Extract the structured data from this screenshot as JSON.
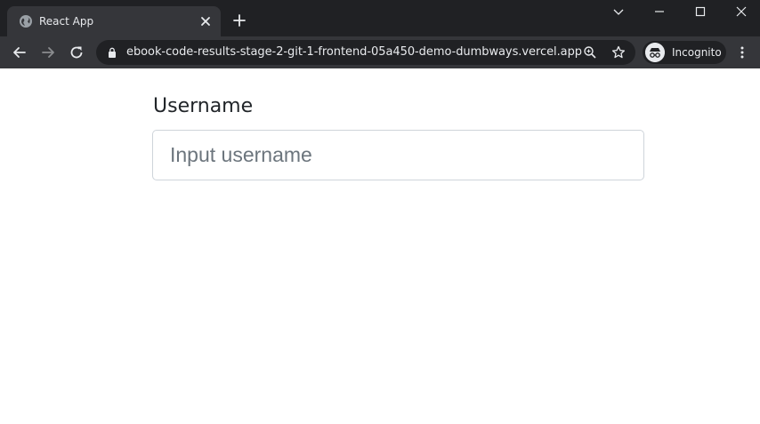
{
  "browser": {
    "tab": {
      "title": "React App"
    },
    "url": "ebook-code-results-stage-2-git-1-frontend-05a450-demo-dumbways.vercel.app",
    "incognito_label": "Incognito",
    "colors": {
      "frame": "#202124",
      "toolbar": "#35363a",
      "text": "#e8eaed"
    }
  },
  "form": {
    "username_label": "Username",
    "username_placeholder": "Input username",
    "username_value": ""
  }
}
